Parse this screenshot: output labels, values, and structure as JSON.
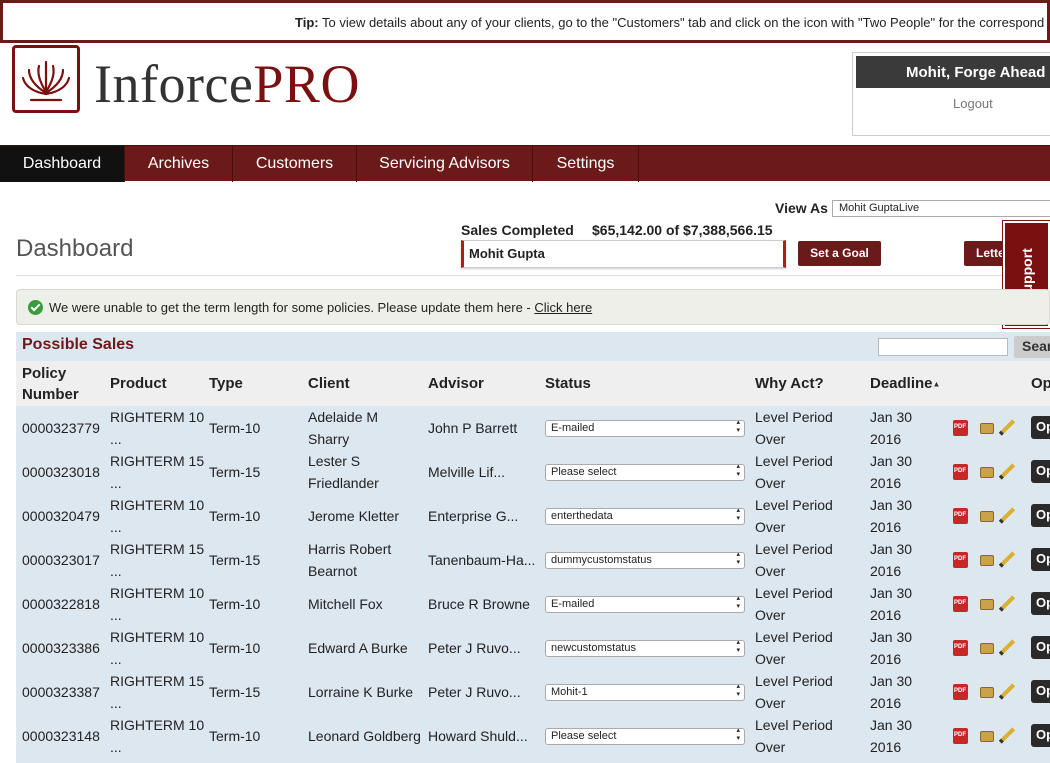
{
  "tip": {
    "label": "Tip:",
    "text": "To view details about any of your clients, go to the \"Customers\" tab and click on the icon with \"Two People\" for the correspond"
  },
  "logo": {
    "part1": "Inforce",
    "part2": "PRO"
  },
  "user": {
    "name": "Mohit, Forge Ahead",
    "logout": "Logout"
  },
  "nav": [
    "Dashboard",
    "Archives",
    "Customers",
    "Servicing Advisors",
    "Settings"
  ],
  "page": {
    "title": "Dashboard"
  },
  "view_as": {
    "label": "View As",
    "value": "Mohit GuptaLive"
  },
  "sales": {
    "label": "Sales Completed",
    "value": "$65,142.00 of $7,388,566.15",
    "bar_text": "Mohit Gupta"
  },
  "buttons": {
    "set_goal": "Set a Goal",
    "letter": "Lette",
    "support": "Support",
    "search": "Sear"
  },
  "alert": {
    "text": "We were unable to get the term length for some policies. Please update them here - ",
    "link": "Click here"
  },
  "table": {
    "title": "Possible Sales",
    "headers": {
      "policy_line1": "Policy",
      "policy_line2": "Number",
      "product": "Product",
      "type": "Type",
      "client": "Client",
      "advisor": "Advisor",
      "status": "Status",
      "why": "Why Act?",
      "deadline": "Deadline",
      "op": "Op"
    },
    "op_label": "Op",
    "rows": [
      {
        "policy": "0000323779",
        "product": "RIGHTERM 10",
        "product_more": "...",
        "type": "Term-10",
        "client1": "Adelaide M",
        "client2": "Sharry",
        "advisor": "John P Barrett",
        "status": "E-mailed",
        "why1": "Level Period",
        "why2": "Over",
        "dl1": "Jan 30",
        "dl2": "2016"
      },
      {
        "policy": "0000323018",
        "product": "RIGHTERM 15",
        "product_more": "...",
        "type": "Term-15",
        "client1": "Lester S",
        "client2": "Friedlander",
        "advisor": "Melville Lif...",
        "status": "Please select",
        "why1": "Level Period",
        "why2": "Over",
        "dl1": "Jan 30",
        "dl2": "2016"
      },
      {
        "policy": "0000320479",
        "product": "RIGHTERM 10",
        "product_more": "...",
        "type": "Term-10",
        "client1": "Jerome Kletter",
        "client2": "",
        "advisor": "Enterprise G...",
        "status": "enterthedata",
        "why1": "Level Period",
        "why2": "Over",
        "dl1": "Jan 30",
        "dl2": "2016"
      },
      {
        "policy": "0000323017",
        "product": "RIGHTERM 15",
        "product_more": "...",
        "type": "Term-15",
        "client1": "Harris Robert",
        "client2": "Bearnot",
        "advisor": "Tanenbaum-Ha...",
        "status": "dummycustomstatus",
        "why1": "Level Period",
        "why2": "Over",
        "dl1": "Jan 30",
        "dl2": "2016"
      },
      {
        "policy": "0000322818",
        "product": "RIGHTERM 10",
        "product_more": "...",
        "type": "Term-10",
        "client1": "Mitchell Fox",
        "client2": "",
        "advisor": "Bruce R Browne",
        "status": "E-mailed",
        "why1": "Level Period",
        "why2": "Over",
        "dl1": "Jan 30",
        "dl2": "2016"
      },
      {
        "policy": "0000323386",
        "product": "RIGHTERM 10",
        "product_more": "...",
        "type": "Term-10",
        "client1": "Edward A Burke",
        "client2": "",
        "advisor": "Peter J Ruvo...",
        "status": "newcustomstatus",
        "why1": "Level Period",
        "why2": "Over",
        "dl1": "Jan 30",
        "dl2": "2016"
      },
      {
        "policy": "0000323387",
        "product": "RIGHTERM 15",
        "product_more": "...",
        "type": "Term-15",
        "client1": "Lorraine K Burke",
        "client2": "",
        "advisor": "Peter J Ruvo...",
        "status": "Mohit-1",
        "why1": "Level Period",
        "why2": "Over",
        "dl1": "Jan 30",
        "dl2": "2016"
      },
      {
        "policy": "0000323148",
        "product": "RIGHTERM 10",
        "product_more": "...",
        "type": "Term-10",
        "client1": "Leonard Goldberg",
        "client2": "",
        "advisor": "Howard Shuld...",
        "status": "Please select",
        "why1": "Level Period",
        "why2": "Over",
        "dl1": "Jan 30",
        "dl2": "2016"
      }
    ]
  },
  "colors": {
    "brand": "#6b1a1a",
    "panel": "#dde7f0",
    "alert_bg": "#efefea",
    "check": "#3a9b3a"
  }
}
